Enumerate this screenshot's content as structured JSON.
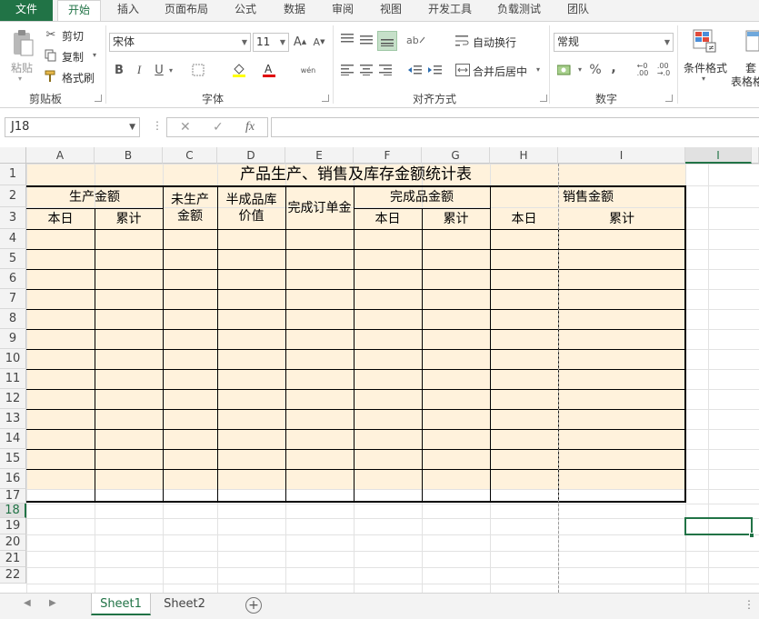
{
  "ribbon_tabs": [
    "文件",
    "开始",
    "插入",
    "页面布局",
    "公式",
    "数据",
    "审阅",
    "视图",
    "开发工具",
    "负载测试",
    "团队"
  ],
  "clipboard": {
    "paste": "粘贴",
    "cut": "剪切",
    "copy": "复制",
    "format_painter": "格式刷",
    "label": "剪贴板"
  },
  "font": {
    "name": "宋体",
    "size": "11",
    "bold": "B",
    "italic": "I",
    "underline": "U",
    "label": "字体"
  },
  "alignment": {
    "wrap": "自动换行",
    "merge": "合并后居中",
    "label": "对齐方式"
  },
  "number": {
    "format": "常规",
    "percent": "%",
    "comma": ",",
    "label": "数字"
  },
  "styles": {
    "conditional": "条件格式",
    "table_partial_1": "套",
    "table_partial_2": "表格格"
  },
  "namebox": "J18",
  "fx": "fx",
  "columns": [
    "A",
    "B",
    "C",
    "D",
    "E",
    "F",
    "G",
    "H",
    "I"
  ],
  "selected_column_label": "I",
  "rows": [
    "1",
    "2",
    "3",
    "4",
    "5",
    "6",
    "7",
    "8",
    "9",
    "10",
    "11",
    "12",
    "13",
    "14",
    "15",
    "16",
    "17",
    "18",
    "19",
    "20",
    "21",
    "22"
  ],
  "sheet": {
    "title": "产品生产、销售及库存金额统计表",
    "production_amount": "生产金额",
    "unfinished": "未生产\n金额",
    "semi_finished": "半成品库\n价值",
    "completed_orders": "完成订单金",
    "finished_amount": "完成品金额",
    "sales_amount": "销售金额",
    "today_1": "本日",
    "cumulative_1": "累计",
    "today_2": "本日",
    "cumulative_2": "累计",
    "today_3": "本日",
    "cumulative_3": "累计"
  },
  "sheet_tabs": [
    "Sheet1",
    "Sheet2"
  ],
  "colors": {
    "accent": "#217346",
    "table_fill": "#fff2dc"
  }
}
